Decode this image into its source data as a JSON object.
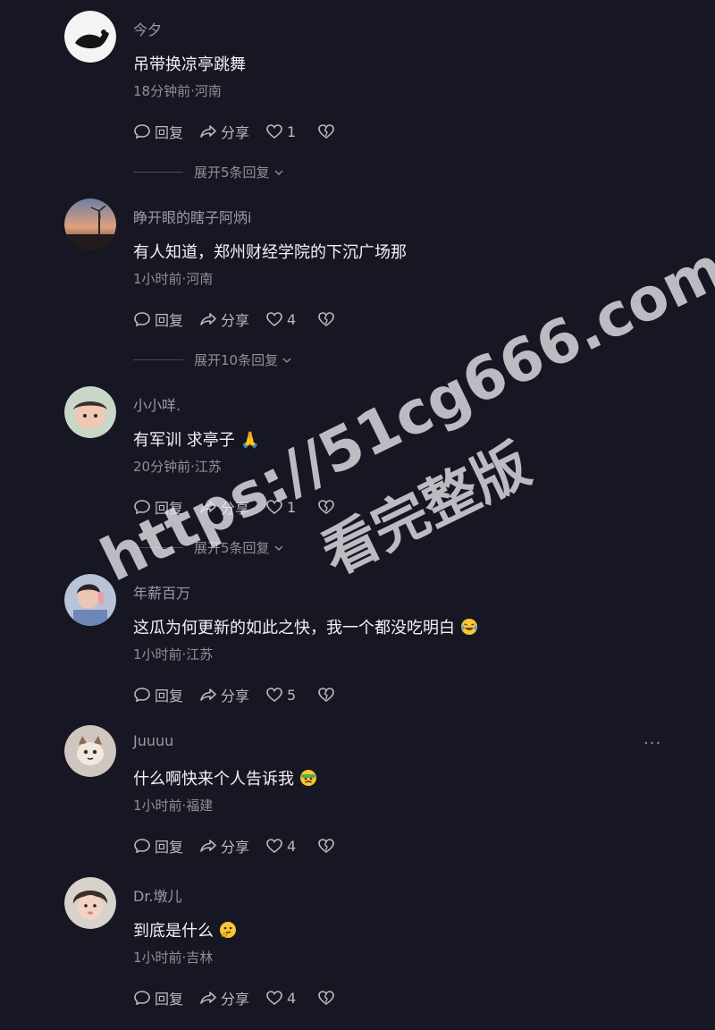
{
  "comments": [
    {
      "username": "今夕",
      "text": "吊带换凉亭跳舞",
      "meta": "18分钟前·河南",
      "reply": "回复",
      "share": "分享",
      "likes": "1",
      "expand": "展开5条回复"
    },
    {
      "username": "睁开眼的瞎子阿炳i",
      "text": "有人知道，郑州财经学院的下沉广场那",
      "meta": "1小时前·河南",
      "reply": "回复",
      "share": "分享",
      "likes": "4",
      "expand": "展开10条回复"
    },
    {
      "username": "小小咩.",
      "text": "有军训 求亭子 🙏",
      "meta": "20分钟前·江苏",
      "reply": "回复",
      "share": "分享",
      "likes": "1",
      "expand": "展开5条回复"
    },
    {
      "username": "年薪百万",
      "text": "这瓜为何更新的如此之快，我一个都没吃明白",
      "meta": "1小时前·江苏",
      "reply": "回复",
      "share": "分享",
      "likes": "5"
    },
    {
      "username": "Juuuu",
      "text": "什么啊快来个人告诉我",
      "meta": "1小时前·福建",
      "reply": "回复",
      "share": "分享",
      "likes": "4",
      "more": "···"
    },
    {
      "username": "Dr.墩儿",
      "text": "到底是什么",
      "meta": "1小时前·吉林",
      "reply": "回复",
      "share": "分享",
      "likes": "4"
    }
  ],
  "watermark": {
    "url": "https://51cg666.com",
    "caption": "看完整版"
  },
  "colors": {
    "background": "#161722",
    "text": "#f2f2f4",
    "secondary": "#8e8f99"
  }
}
